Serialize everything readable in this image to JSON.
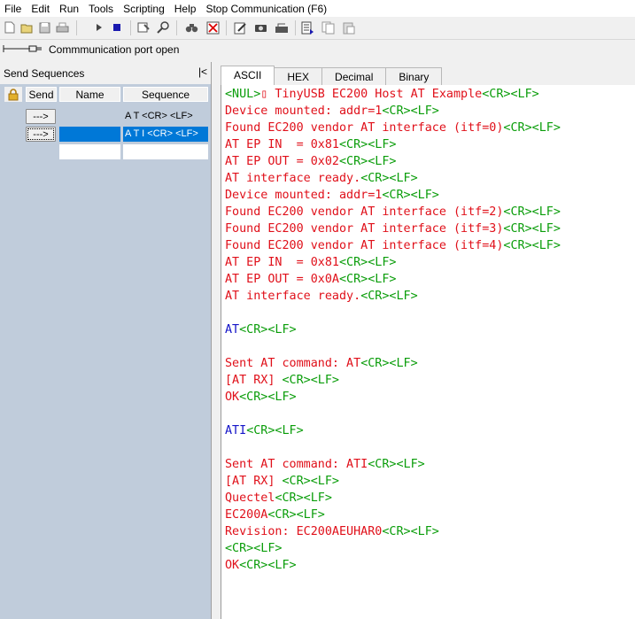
{
  "menu": {
    "items": [
      "File",
      "Edit",
      "Run",
      "Tools",
      "Scripting",
      "Help",
      "Stop Communication  (F6)"
    ]
  },
  "toolbar": {
    "buttons": [
      "new-file-icon",
      "open-folder-icon",
      "save-icon",
      "print-icon",
      "play-icon",
      "stop-icon",
      "settings-icon",
      "search-icon",
      "binoculars-icon",
      "clear-icon",
      "edit-icon",
      "camera-icon",
      "keyboard-icon",
      "script-icon",
      "copy-icon",
      "paste-icon"
    ]
  },
  "status": {
    "port_text": "Commmunication port open"
  },
  "send_sequences": {
    "title": "Send Sequences",
    "collapse_label": "|<",
    "col_send": "Send",
    "col_name": "Name",
    "col_sequence": "Sequence",
    "rows": [
      {
        "send_label": "--->",
        "name": "",
        "sequence": "A T <CR> <LF>",
        "selected": false
      },
      {
        "send_label": "--->",
        "name": "",
        "sequence": "A T I <CR> <LF>",
        "selected": true
      },
      {
        "send_label": "",
        "name": "",
        "sequence": "",
        "selected": false
      }
    ]
  },
  "tabs": [
    "ASCII",
    "HEX",
    "Decimal",
    "Binary"
  ],
  "active_tab": "ASCII",
  "colors": {
    "received_text": "#e0101a",
    "control_chars": "#0a9d0a",
    "sent_text": "#1414c8",
    "selection": "#0078d7",
    "panel_bg": "#c0ccdb"
  },
  "console": {
    "lines": [
      [
        [
          "g",
          "<NUL>"
        ],
        [
          "r",
          "▯ TinyUSB EC200 Host AT Example"
        ],
        [
          "g",
          "<CR><LF>"
        ]
      ],
      [
        [
          "r",
          "Device mounted: addr=1"
        ],
        [
          "g",
          "<CR><LF>"
        ]
      ],
      [
        [
          "r",
          "Found EC200 vendor AT interface (itf=0)"
        ],
        [
          "g",
          "<CR><LF>"
        ]
      ],
      [
        [
          "r",
          "AT EP IN  = 0x81"
        ],
        [
          "g",
          "<CR><LF>"
        ]
      ],
      [
        [
          "r",
          "AT EP OUT = 0x02"
        ],
        [
          "g",
          "<CR><LF>"
        ]
      ],
      [
        [
          "r",
          "AT interface ready."
        ],
        [
          "g",
          "<CR><LF>"
        ]
      ],
      [
        [
          "r",
          "Device mounted: addr=1"
        ],
        [
          "g",
          "<CR><LF>"
        ]
      ],
      [
        [
          "r",
          "Found EC200 vendor AT interface (itf=2)"
        ],
        [
          "g",
          "<CR><LF>"
        ]
      ],
      [
        [
          "r",
          "Found EC200 vendor AT interface (itf=3)"
        ],
        [
          "g",
          "<CR><LF>"
        ]
      ],
      [
        [
          "r",
          "Found EC200 vendor AT interface (itf=4)"
        ],
        [
          "g",
          "<CR><LF>"
        ]
      ],
      [
        [
          "r",
          "AT EP IN  = 0x81"
        ],
        [
          "g",
          "<CR><LF>"
        ]
      ],
      [
        [
          "r",
          "AT EP OUT = 0x0A"
        ],
        [
          "g",
          "<CR><LF>"
        ]
      ],
      [
        [
          "r",
          "AT interface ready."
        ],
        [
          "g",
          "<CR><LF>"
        ]
      ],
      [],
      [
        [
          "b",
          "AT"
        ],
        [
          "g",
          "<CR><LF>"
        ]
      ],
      [],
      [
        [
          "r",
          "Sent AT command: AT"
        ],
        [
          "g",
          "<CR><LF>"
        ]
      ],
      [
        [
          "r",
          "[AT RX] "
        ],
        [
          "g",
          "<CR><LF>"
        ]
      ],
      [
        [
          "r",
          "OK"
        ],
        [
          "g",
          "<CR><LF>"
        ]
      ],
      [],
      [
        [
          "b",
          "ATI"
        ],
        [
          "g",
          "<CR><LF>"
        ]
      ],
      [],
      [
        [
          "r",
          "Sent AT command: ATI"
        ],
        [
          "g",
          "<CR><LF>"
        ]
      ],
      [
        [
          "r",
          "[AT RX] "
        ],
        [
          "g",
          "<CR><LF>"
        ]
      ],
      [
        [
          "r",
          "Quectel"
        ],
        [
          "g",
          "<CR><LF>"
        ]
      ],
      [
        [
          "r",
          "EC200A"
        ],
        [
          "g",
          "<CR><LF>"
        ]
      ],
      [
        [
          "r",
          "Revision: EC200AEUHAR0"
        ],
        [
          "g",
          "<CR><LF>"
        ]
      ],
      [
        [
          "g",
          "<CR><LF>"
        ]
      ],
      [
        [
          "r",
          "OK"
        ],
        [
          "g",
          "<CR><LF>"
        ]
      ]
    ]
  }
}
